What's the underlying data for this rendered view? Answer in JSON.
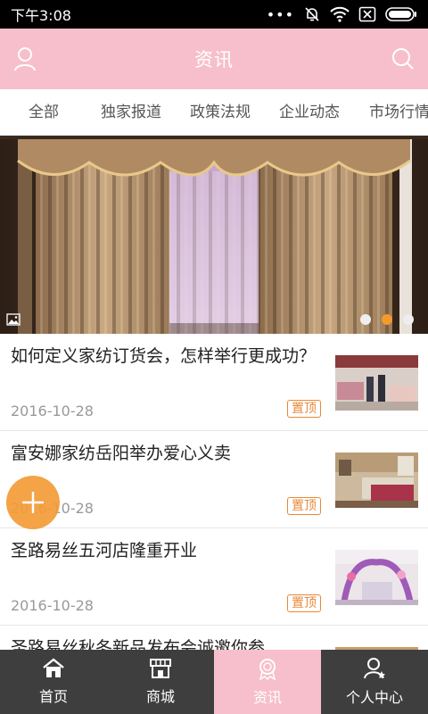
{
  "status_bar": {
    "time": "下午3:08"
  },
  "header": {
    "title": "资讯",
    "left_icon": "user-icon",
    "right_icon": "search-icon"
  },
  "tabs": [
    {
      "label": "全部"
    },
    {
      "label": "独家报道"
    },
    {
      "label": "政策法规"
    },
    {
      "label": "企业动态"
    },
    {
      "label": "市场行情"
    }
  ],
  "banner": {
    "slide_count": 3,
    "active_slide": 2
  },
  "news": [
    {
      "title": "如何定义家纺订货会，怎样举行更成功？",
      "date": "2016-10-28",
      "badge": "置顶"
    },
    {
      "title": "富安娜家纺岳阳举办爱心义卖",
      "date": "2016-10-28",
      "badge": "置顶"
    },
    {
      "title": "圣路易丝五河店隆重开业",
      "date": "2016-10-28",
      "badge": "置顶"
    },
    {
      "title": "圣路易丝秋冬新品发布会诚邀你参",
      "date": "",
      "badge": ""
    }
  ],
  "bottom_nav": [
    {
      "label": "首页",
      "icon": "home-icon"
    },
    {
      "label": "商城",
      "icon": "store-icon"
    },
    {
      "label": "资讯",
      "icon": "news-icon",
      "active": true
    },
    {
      "label": "个人中心",
      "icon": "profile-icon"
    }
  ],
  "colors": {
    "header": "#f7bfcb",
    "accent": "#f29a2e",
    "nav_bg": "#3e3e3e"
  }
}
